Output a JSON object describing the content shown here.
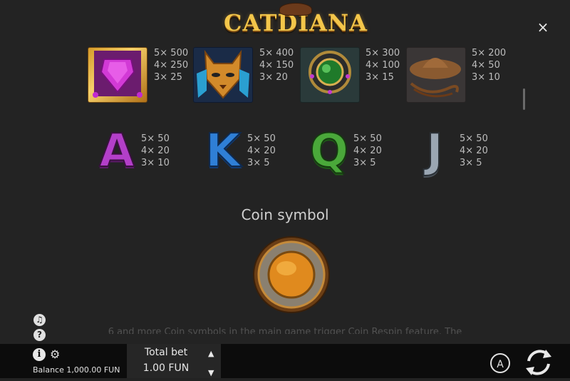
{
  "logo": {
    "text": "CATDIANA"
  },
  "close_icon": "×",
  "high_symbols": [
    {
      "name": "pink-gem",
      "pays": [
        "5× 500",
        "4× 250",
        "3× 25"
      ]
    },
    {
      "name": "cat-mask",
      "pays": [
        "5× 400",
        "4× 150",
        "3× 20"
      ]
    },
    {
      "name": "emerald-amulet",
      "pays": [
        "5× 300",
        "4× 100",
        "3× 15"
      ]
    },
    {
      "name": "hat-whip",
      "pays": [
        "5× 200",
        "4× 50",
        "3× 10"
      ]
    }
  ],
  "low_symbols": [
    {
      "letter": "A",
      "color": "#b33fc9",
      "pays": [
        "5× 50",
        "4× 20",
        "3× 10"
      ]
    },
    {
      "letter": "K",
      "color": "#2f7fd6",
      "pays": [
        "5× 50",
        "4× 20",
        "3× 5"
      ]
    },
    {
      "letter": "Q",
      "color": "#4aa83a",
      "pays": [
        "5× 50",
        "4× 20",
        "3× 5"
      ]
    },
    {
      "letter": "J",
      "color": "#9aa6b3",
      "pays": [
        "5× 50",
        "4× 20",
        "3× 5"
      ]
    }
  ],
  "coin": {
    "title": "Coin symbol",
    "description": "6 and more Coin symbols in the main game trigger Coin Respin feature. The"
  },
  "bottom": {
    "balance_label": "Balance 1,000.00 FUN",
    "total_bet_label": "Total bet",
    "total_bet_value": "1.00 FUN",
    "info_glyph": "i",
    "auto_label": "A"
  }
}
